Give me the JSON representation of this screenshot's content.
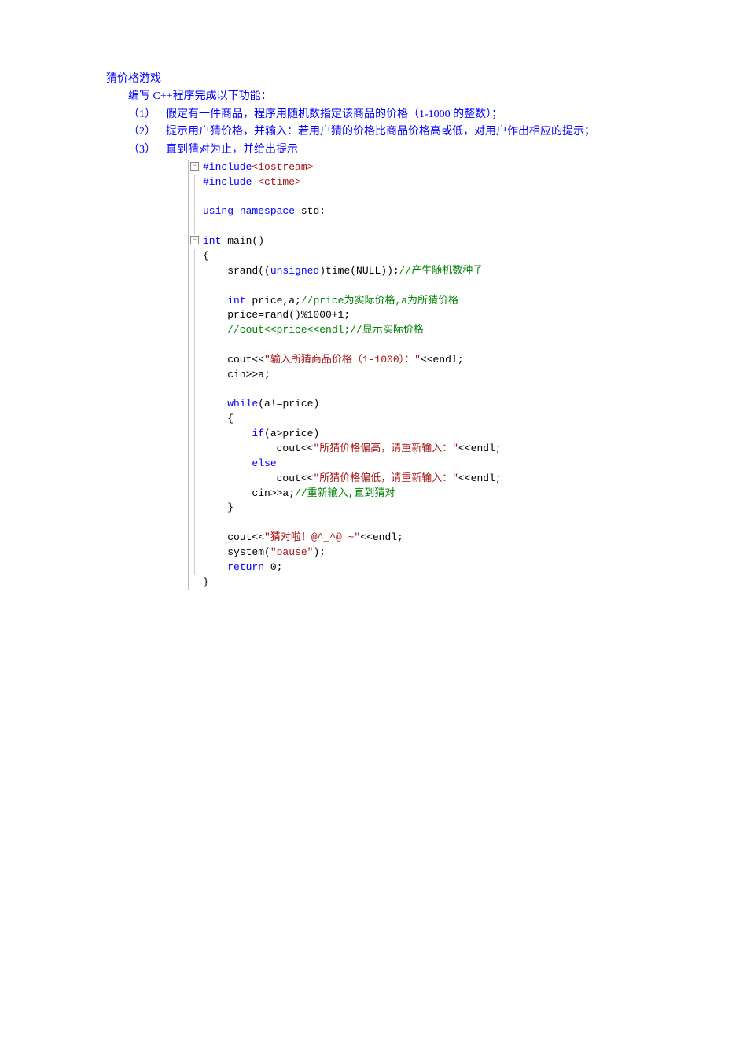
{
  "title": "猜价格游戏",
  "intro": "编写 C++程序完成以下功能：",
  "items": [
    {
      "num": "（1）",
      "text": "假定有一件商品，程序用随机数指定该商品的价格（1-1000 的整数）；"
    },
    {
      "num": "（2）",
      "text": "提示用户猜价格，并输入：若用户猜的价格比商品价格高或低，对用户作出相应的提示；"
    },
    {
      "num": "（3）",
      "text": "直到猜对为止，并给出提示"
    }
  ],
  "code": {
    "l1a": "#include",
    "l1b": "<iostream>",
    "l2a": "#include ",
    "l2b": "<ctime>",
    "l3": "",
    "l4a": "using",
    "l4b": " ",
    "l4c": "namespace",
    "l4d": " std;",
    "l5": "",
    "l6a": "int",
    "l6b": " main()",
    "l7": "{",
    "l8a": "    srand((",
    "l8b": "unsigned",
    "l8c": ")time(NULL));",
    "l8d": "//产生随机数种子",
    "l9": "",
    "l10a": "    ",
    "l10b": "int",
    "l10c": " price,a;",
    "l10d": "//price为实际价格,a为所猜价格",
    "l11": "    price=rand()%1000+1;",
    "l12": "    //cout<<price<<endl;//显示实际价格",
    "l13": "",
    "l14a": "    cout<<",
    "l14b": "\"输入所猜商品价格（1-1000）：\"",
    "l14c": "<<endl;",
    "l15": "    cin>>a;",
    "l16": "",
    "l17a": "    ",
    "l17b": "while",
    "l17c": "(a!=price)",
    "l18": "    {",
    "l19a": "        ",
    "l19b": "if",
    "l19c": "(a>price)",
    "l20a": "            cout<<",
    "l20b": "\"所猜价格偏高，请重新输入：\"",
    "l20c": "<<endl;",
    "l21a": "        ",
    "l21b": "else",
    "l22a": "            cout<<",
    "l22b": "\"所猜价格偏低，请重新输入：\"",
    "l22c": "<<endl;",
    "l23a": "        cin>>a;",
    "l23b": "//重新输入,直到猜对",
    "l24": "    }",
    "l25": "",
    "l26a": "    cout<<",
    "l26b": "\"猜对啦！@^_^@ ~\"",
    "l26c": "<<endl;",
    "l27a": "    system(",
    "l27b": "\"pause\"",
    "l27c": ");",
    "l28a": "    ",
    "l28b": "return",
    "l28c": " 0;",
    "l29": "}"
  }
}
